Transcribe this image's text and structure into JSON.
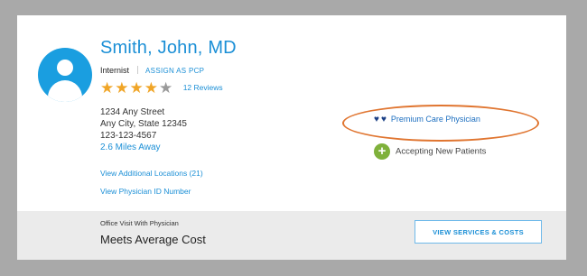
{
  "doctor": {
    "name": "Smith, John, MD",
    "specialty": "Internist",
    "assign_pcp": "ASSIGN AS PCP",
    "rating": 4,
    "rating_max": 5,
    "reviews": "12 Reviews",
    "address": {
      "street": "1234 Any Street",
      "city_state_zip": "Any City, State  12345",
      "phone": "123-123-4567",
      "distance": "2.6 Miles Away"
    },
    "additional_locations": "View Additional Locations (21)",
    "physician_id": "View Physician ID Number"
  },
  "badges": {
    "premium": "Premium Care Physician",
    "accepting": "Accepting New Patients"
  },
  "footer": {
    "visit_label": "Office Visit With Physician",
    "cost": "Meets Average Cost",
    "button": "VIEW SERVICES & COSTS"
  },
  "colors": {
    "link": "#1b8fd6",
    "star": "#f0a527",
    "heart": "#1a3f85",
    "accepting": "#7fb13b",
    "highlight": "#e07530"
  },
  "icons": {
    "avatar": "person-avatar-icon",
    "star": "star-icon",
    "heart": "heart-icon",
    "plus": "plus-circle-icon"
  }
}
